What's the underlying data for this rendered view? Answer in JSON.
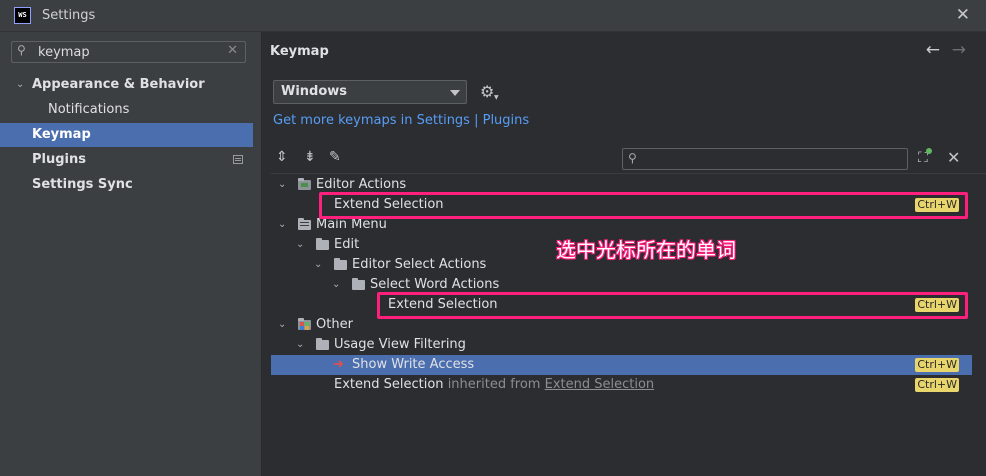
{
  "window": {
    "title": "Settings",
    "app_logo": "WS",
    "close_icon": "close-icon"
  },
  "sidebar": {
    "search": {
      "value": "keymap",
      "placeholder": ""
    },
    "items": [
      {
        "label": "Appearance & Behavior",
        "expanded": true,
        "bold": true
      },
      {
        "label": "Notifications",
        "bold": false
      },
      {
        "label": "Keymap",
        "bold": true,
        "selected": true
      },
      {
        "label": "Plugins",
        "bold": true,
        "has_page_icon": true
      },
      {
        "label": "Settings Sync",
        "bold": true
      }
    ]
  },
  "main": {
    "title": "Keymap",
    "scheme": {
      "selected": "Windows"
    },
    "get_more_link": "Get more keymaps in Settings | Plugins",
    "filter": {
      "value": "",
      "placeholder": ""
    },
    "tree": [
      {
        "label": "Editor Actions",
        "type": "group",
        "icon": "editor-actions-icon"
      },
      {
        "label": "Extend Selection",
        "type": "action",
        "shortcut": "Ctrl+W"
      },
      {
        "label": "Main Menu",
        "type": "group",
        "icon": "main-menu-icon"
      },
      {
        "label": "Edit",
        "type": "folder"
      },
      {
        "label": "Editor Select Actions",
        "type": "folder"
      },
      {
        "label": "Select Word Actions",
        "type": "folder"
      },
      {
        "label": "Extend Selection",
        "type": "action",
        "shortcut": "Ctrl+W"
      },
      {
        "label": "Other",
        "type": "group",
        "icon": "other-icon"
      },
      {
        "label": "Usage View Filtering",
        "type": "folder"
      },
      {
        "label": "Show Write Access",
        "type": "action",
        "shortcut": "Ctrl+W",
        "selected": true
      },
      {
        "label": "Extend Selection",
        "suffix_gray": "inherited from",
        "suffix_link": "Extend Selection",
        "type": "action",
        "shortcut": "Ctrl+W"
      }
    ]
  },
  "annotation": {
    "text": "选中光标所在的单词",
    "color": "#ff1f7d"
  },
  "colors": {
    "accent": "#4b6eaf",
    "link": "#589df6",
    "shortcut_bg": "#e8d56b",
    "highlight_box": "#ff1f7d"
  }
}
